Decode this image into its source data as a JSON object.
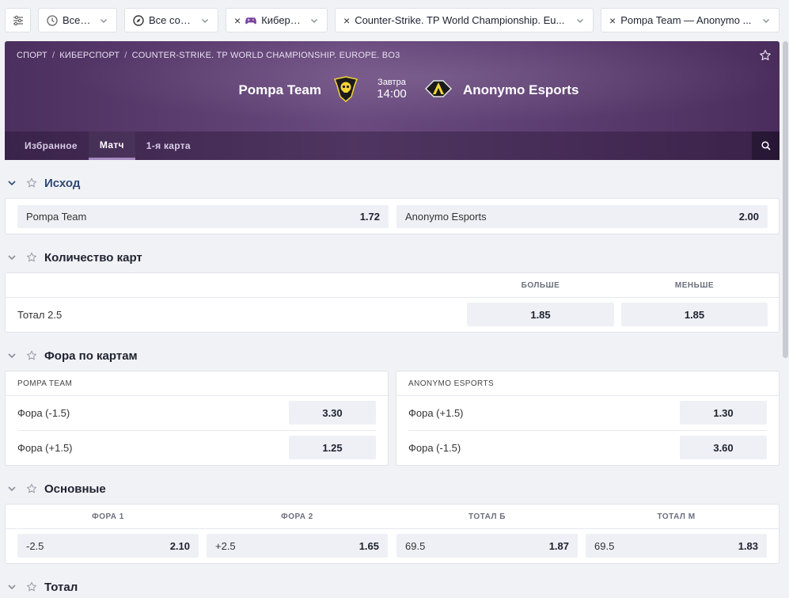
{
  "filters": {
    "settings_icon": "sliders-icon",
    "chips": [
      {
        "label": "Все в...",
        "icon": "clock-icon"
      },
      {
        "label": "Все соб...",
        "icon": "compass-icon"
      },
      {
        "label": "Киберс...",
        "icon": "gamepad-icon"
      },
      {
        "label": "Counter-Strike. TP World Championship. Eu..."
      },
      {
        "label": "Pompa Team — Anonymo ..."
      }
    ]
  },
  "breadcrumb": [
    "Спорт",
    "Киберспорт",
    "Counter-Strike. TP World Championship. Europe. Bo3"
  ],
  "match": {
    "home": "Pompa Team",
    "away": "Anonymo Esports",
    "day": "Завтра",
    "time": "14:00"
  },
  "tabs": [
    "Избранное",
    "Матч",
    "1-я карта"
  ],
  "active_tab": "Матч",
  "sections": {
    "outcome": {
      "title": "Исход",
      "odds": [
        {
          "name": "Pompa Team",
          "value": "1.72"
        },
        {
          "name": "Anonymo Esports",
          "value": "2.00"
        }
      ]
    },
    "maps_count": {
      "title": "Количество карт",
      "col_over": "Больше",
      "col_under": "Меньше",
      "row_label": "Тотал 2.5",
      "over": "1.85",
      "under": "1.85"
    },
    "map_handicap": {
      "title": "Фора по картам",
      "left": {
        "team": "Pompa Team",
        "rows": [
          {
            "label": "Фора (-1.5)",
            "value": "3.30"
          },
          {
            "label": "Фора (+1.5)",
            "value": "1.25"
          }
        ]
      },
      "right": {
        "team": "Anonymo Esports",
        "rows": [
          {
            "label": "Фора (+1.5)",
            "value": "1.30"
          },
          {
            "label": "Фора (-1.5)",
            "value": "3.60"
          }
        ]
      }
    },
    "main": {
      "title": "Основные",
      "columns": [
        "Фора 1",
        "Фора 2",
        "Тотал Б",
        "Тотал М"
      ],
      "odds": [
        {
          "name": "-2.5",
          "value": "2.10"
        },
        {
          "name": "+2.5",
          "value": "1.65"
        },
        {
          "name": "69.5",
          "value": "1.87"
        },
        {
          "name": "69.5",
          "value": "1.83"
        }
      ]
    },
    "total": {
      "title": "Тотал"
    }
  },
  "colors": {
    "header_purple": "#5d3e72",
    "accent_title": "#2e4a74",
    "odd_bg": "#eef0f5"
  }
}
